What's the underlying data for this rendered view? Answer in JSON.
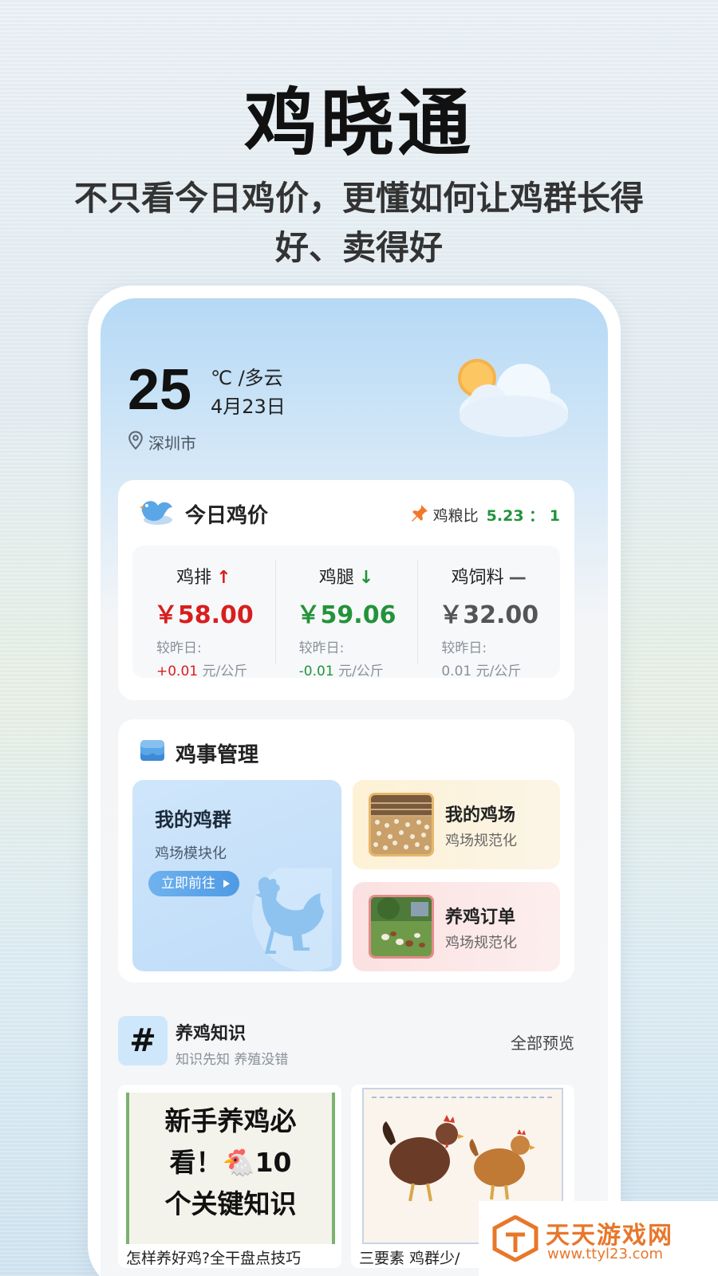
{
  "promo": {
    "headline": "鸡晓通",
    "tagline": "不只看今日鸡价，更懂如何让鸡群长得好、卖得好"
  },
  "weather": {
    "temperature": "25",
    "unit_condition": "℃ /多云",
    "date": "4月23日",
    "city": "深圳市",
    "icon": "partly-cloudy-icon"
  },
  "price_card": {
    "title": "今日鸡价",
    "ratio_label": "鸡粮比",
    "ratio_value": "5.23 ： 1",
    "items": [
      {
        "name": "鸡排",
        "trend": "↑",
        "price": "￥58.00",
        "compare_label": "较昨日:",
        "change": "+0.01",
        "unit": "元/公斤"
      },
      {
        "name": "鸡腿",
        "trend": "↓",
        "price": "￥59.06",
        "compare_label": "较昨日:",
        "change": "-0.01",
        "unit": "元/公斤"
      },
      {
        "name": "鸡饲料",
        "trend": "—",
        "price": "￥32.00",
        "compare_label": "较昨日:",
        "change": "0.01",
        "unit": "元/公斤"
      }
    ],
    "colors": {
      "up": "#d81e1e",
      "down": "#23933a",
      "flat": "#555555"
    }
  },
  "management": {
    "title": "鸡事管理",
    "flock": {
      "title": "我的鸡群",
      "subtitle": "鸡场模块化",
      "button": "立即前往"
    },
    "farm": {
      "title": "我的鸡场",
      "subtitle": "鸡场规范化"
    },
    "orders": {
      "title": "养鸡订单",
      "subtitle": "鸡场规范化"
    }
  },
  "knowledge": {
    "title": "养鸡知识",
    "subtitle": "知识先知 养殖没错",
    "more": "全部预览",
    "articles": [
      {
        "poster_lines": [
          "新手养鸡必",
          "看！🐔10",
          "个关键知识"
        ],
        "caption": "怎样养好鸡?全干盘点技巧"
      },
      {
        "poster_lines": [],
        "caption": "三要素 鸡群少/"
      }
    ]
  },
  "watermark": {
    "name": "天天游戏网",
    "url": "www.ttyl23.com"
  }
}
